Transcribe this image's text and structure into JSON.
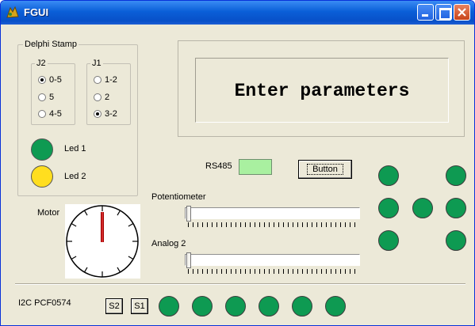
{
  "window": {
    "title": "FGUI"
  },
  "delphi_stamp": {
    "label": "Delphi Stamp",
    "j2": {
      "label": "J2",
      "options": [
        "0-5",
        "5",
        "4-5"
      ],
      "selected": 0
    },
    "j1": {
      "label": "J1",
      "options": [
        "1-2",
        "2",
        "3-2"
      ],
      "selected": 2
    },
    "leds": [
      {
        "label": "Led 1",
        "color": "#0e9a52"
      },
      {
        "label": "Led 2",
        "color": "#ffde1f"
      }
    ]
  },
  "display": {
    "text": "Enter parameters"
  },
  "rs485": {
    "label": "RS485",
    "color": "#a9f0a0"
  },
  "main_button": {
    "label": "Button"
  },
  "potentiometer": {
    "label": "Potentiometer",
    "value": 0
  },
  "analog2": {
    "label": "Analog 2",
    "value": 0
  },
  "motor": {
    "label": "Motor"
  },
  "i2c": {
    "label": "I2C  PCF0574",
    "buttons": [
      "S2",
      "S1"
    ],
    "led_count": 6,
    "led_color": "#0e9a52"
  },
  "right_leds": {
    "count": 7,
    "color": "#0e9a52"
  }
}
